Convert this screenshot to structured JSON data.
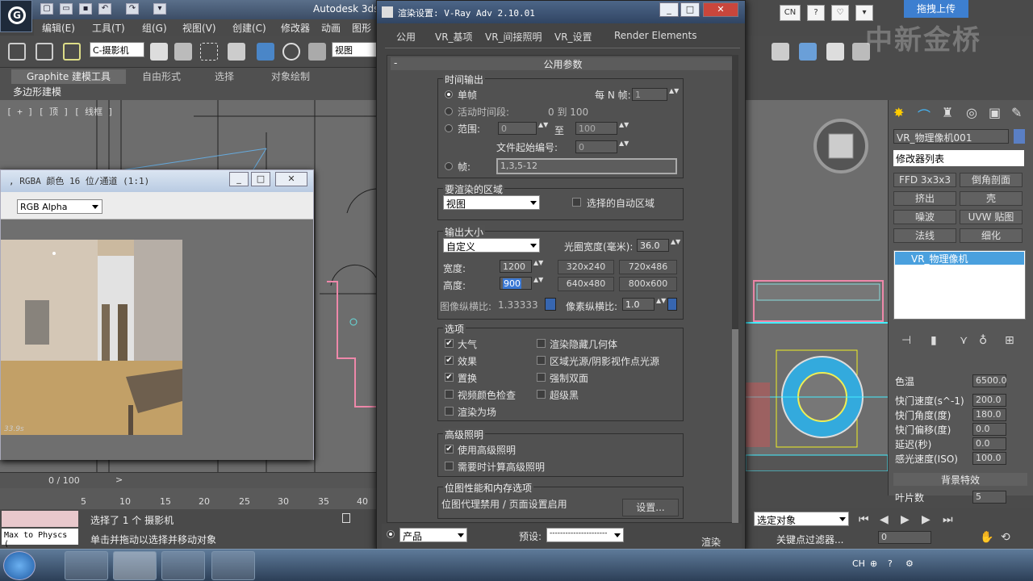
{
  "app": {
    "title": "Autodesk 3ds",
    "logo_label": "G",
    "menus": [
      "编辑(E)",
      "工具(T)",
      "组(G)",
      "视图(V)",
      "创建(C)",
      "修改器",
      "动画",
      "图形"
    ],
    "camera_select": "C-摄影机",
    "view_select": "视图",
    "ribbon_tabs": [
      "Graphite 建模工具",
      "自由形式",
      "选择",
      "对象绘制"
    ],
    "ribbon_sub": "多边形建模",
    "viewport_label": "[ + ] [ 顶 ] [ 线框 ]",
    "watermark": "中新金桥",
    "upload_label": "拖拽上传",
    "top_badge_cn": "CN"
  },
  "frame_buffer": {
    "title": ", RGBA 颜色 16 位/通道 (1:1)",
    "channel": "RGB Alpha",
    "render_time": "33.9s",
    "min_label": "_",
    "max_label": "□",
    "close_label": "✕"
  },
  "timeline": {
    "counter": "0 / 100",
    "ticks": [
      "5",
      "10",
      "15",
      "20",
      "25",
      "30",
      "35",
      "40"
    ],
    "prev_arrow": "<",
    "next_arrow": ">"
  },
  "status": {
    "maxscript": "Max to Physcs (",
    "line1": "选择了 1 个 摄影机",
    "line2": "单击并拖动以选择并移动对象"
  },
  "render_dialog": {
    "title": "渲染设置: V-Ray Adv 2.10.01",
    "tabs": [
      "公用",
      "VR_基项",
      "VR_间接照明",
      "VR_设置",
      "Render Elements"
    ],
    "rollout": "公用参数",
    "rollout_minus": "-",
    "time_output": {
      "title": "时间输出",
      "single": "单帧",
      "every_n_label": "每 N 帧:",
      "every_n_value": "1",
      "active_segment": "活动时间段:",
      "active_range": "0 到 100",
      "range_label": "范围:",
      "range_from": "0",
      "to_label": "至",
      "range_to": "100",
      "file_start_label": "文件起始编号:",
      "file_start_value": "0",
      "frames_label": "帧:",
      "frames_value": "1,3,5-12"
    },
    "area": {
      "title": "要渲染的区域",
      "value": "视图",
      "auto_region": "选择的自动区域"
    },
    "output_size": {
      "title": "输出大小",
      "preset": "自定义",
      "aperture_label": "光圈宽度(毫米):",
      "aperture_value": "36.0",
      "width_label": "宽度:",
      "width_value": "1200",
      "height_label": "高度:",
      "height_value": "900",
      "presets": [
        "320x240",
        "720x486",
        "640x480",
        "800x600"
      ],
      "image_aspect_label": "图像纵横比:",
      "image_aspect_value": "1.33333",
      "pixel_aspect_label": "像素纵横比:",
      "pixel_aspect_value": "1.0"
    },
    "options": {
      "title": "选项",
      "items_left": [
        {
          "label": "大气",
          "checked": true
        },
        {
          "label": "效果",
          "checked": true
        },
        {
          "label": "置换",
          "checked": true
        },
        {
          "label": "视频颜色检查",
          "checked": false
        },
        {
          "label": "渲染为场",
          "checked": false
        }
      ],
      "items_right": [
        {
          "label": "渲染隐藏几何体",
          "checked": false
        },
        {
          "label": "区域光源/阴影视作点光源",
          "checked": false
        },
        {
          "label": "强制双面",
          "checked": false
        },
        {
          "label": "超级黑",
          "checked": false
        }
      ]
    },
    "advanced_lighting": {
      "title": "高级照明",
      "use": "使用高级照明",
      "compute": "需要时计算高级照明"
    },
    "bitmap": {
      "title": "位图性能和内存选项",
      "text": "位图代理禁用 / 页面设置启用",
      "settings": "设置..."
    },
    "bottom": {
      "product": "产品",
      "preset_label": "预设:",
      "preset_value": "----------------------",
      "render": "渲染"
    },
    "min_label": "_",
    "max_label": "□",
    "close_label": "✕"
  },
  "command_panel": {
    "object_name": "VR_物理像机001",
    "modifier_list": "修改器列表",
    "modifiers": [
      "FFD 3x3x3",
      "倒角剖面",
      "挤出",
      "壳",
      "噪波",
      "UVW 贴图",
      "法线",
      "细化"
    ],
    "stack_item": "VR_物理像机",
    "params": [
      {
        "label": "色温",
        "value": "6500.0"
      },
      {
        "label": "快门速度(s^-1)",
        "value": "200.0"
      },
      {
        "label": "快门角度(度)",
        "value": "180.0"
      },
      {
        "label": "快门偏移(度)",
        "value": "0.0"
      },
      {
        "label": "延迟(秒)",
        "value": "0.0"
      },
      {
        "label": "感光速度(ISO)",
        "value": "100.0"
      }
    ],
    "bg_effects": "背景特效",
    "leaf_count": "叶片数",
    "leaf_value": "5"
  },
  "anim": {
    "select_label": "选定对象",
    "filter_label": "关键点过滤器...",
    "frame_value": "0"
  },
  "taskbar": {
    "lang": "CH"
  },
  "colors": {
    "accent": "#4aa0de",
    "dialog_bg": "#505050"
  }
}
